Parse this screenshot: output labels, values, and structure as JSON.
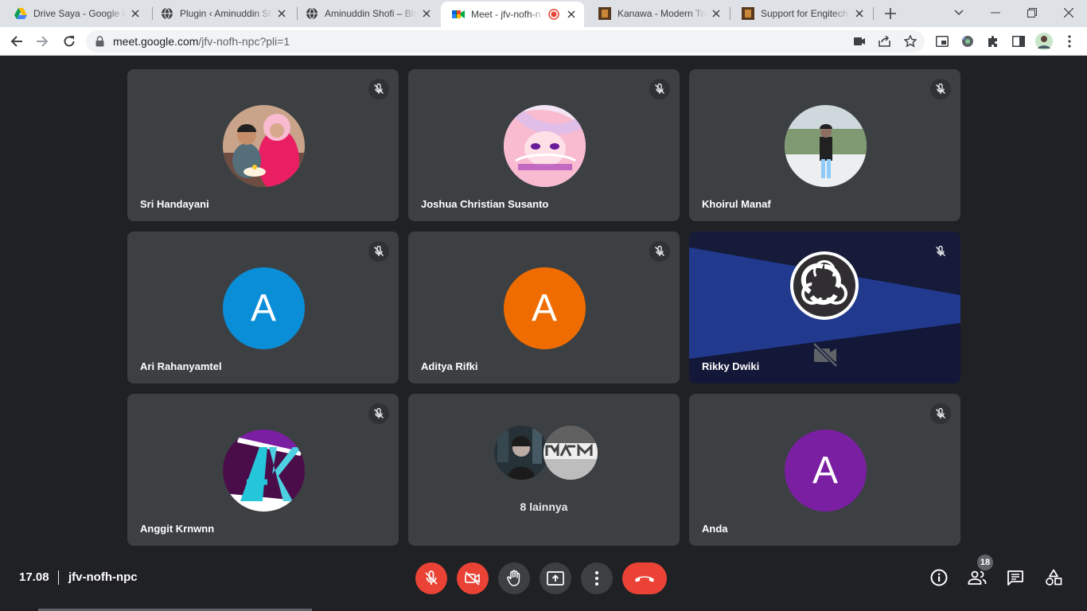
{
  "browser": {
    "tabs": [
      {
        "title": "Drive Saya - Google D",
        "icon": "google-drive-icon"
      },
      {
        "title": "Plugin ‹ Aminuddin Sh",
        "icon": "globe-icon"
      },
      {
        "title": "Aminuddin Shofi – Blo",
        "icon": "globe-icon"
      },
      {
        "title": "Meet - jfv-nofh-n",
        "icon": "google-meet-icon",
        "active": true,
        "recording": true
      },
      {
        "title": "Kanawa - Modern Tra",
        "icon": "site-thumbnail-icon"
      },
      {
        "title": "Support for Engitech",
        "icon": "site-thumbnail-icon"
      }
    ],
    "url_host": "meet.google.com",
    "url_path": "/jfv-nofh-npc?pli=1"
  },
  "participants": [
    {
      "name": "Sri Handayani",
      "avatar": "photo",
      "muted": true
    },
    {
      "name": "Joshua Christian Susanto",
      "avatar": "photo",
      "muted": true
    },
    {
      "name": "Khoirul Manaf",
      "avatar": "photo",
      "muted": true
    },
    {
      "name": "Ari Rahanyamtel",
      "avatar_letter": "A",
      "avatar_color": "#0b8ed8",
      "muted": true
    },
    {
      "name": "Aditya Rifki",
      "avatar_letter": "A",
      "avatar_color": "#ef6c00",
      "muted": true
    },
    {
      "name": "Rikky Dwiki",
      "avatar": "obs-logo",
      "camera_off": true,
      "muted": true
    },
    {
      "name": "Anggit Krnwnn",
      "avatar": "ak-logo",
      "muted": true
    },
    {
      "name": "",
      "others_label": "8 lainnya"
    },
    {
      "name": "Anda",
      "avatar_letter": "A",
      "avatar_color": "#7b1fa2",
      "muted": true
    }
  ],
  "footer": {
    "time": "17.08",
    "meeting_code": "jfv-nofh-npc",
    "people_count": "18"
  },
  "colors": {
    "background": "#202124",
    "tile": "#3c4043",
    "danger": "#ea4335"
  }
}
